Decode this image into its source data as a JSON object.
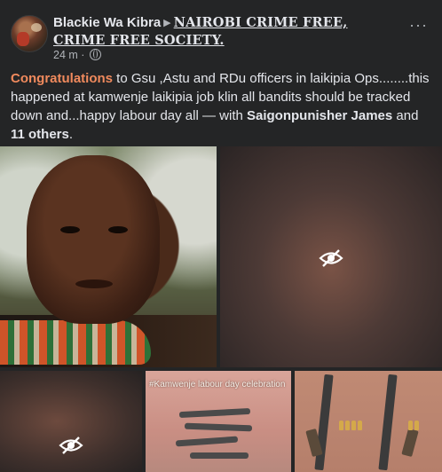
{
  "post": {
    "author": "Blackie Wa Kibra",
    "group": "NAIROBI CRIME FREE, CRIME FREE SOCIETY.",
    "time": "24 m",
    "more": "···",
    "text_highlight": "Congratulations",
    "text_body": " to Gsu ,Astu and RDu officers in laikipia Ops........this happened at kamwenje laikipia job klin all bandits should be tracked down and...happy labour day all — with ",
    "tag1": "Saigonpunisher James",
    "and": " and ",
    "tag2": "11 others",
    "period": "."
  },
  "images": {
    "caption4": "#Kamwenje labour day celebration",
    "hidden_icon": "eye-slash-icon"
  },
  "colors": {
    "background": "#242526",
    "text": "#e4e6eb",
    "secondary": "#b0b3b8",
    "highlight": "#f08a5d"
  }
}
